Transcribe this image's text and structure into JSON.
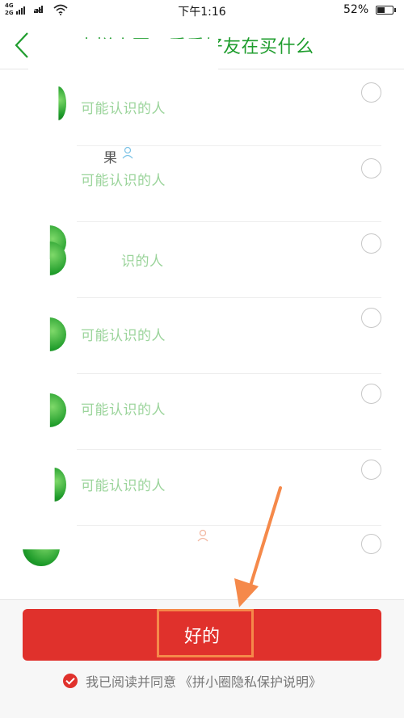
{
  "status_bar": {
    "network_top": "4G",
    "network_bottom": "2G",
    "network2": "2G",
    "time": "下午1:16",
    "battery_percent": "52%",
    "battery_level": 0.52
  },
  "header": {
    "title": "来拼小圈，看看好友在买什么"
  },
  "friends": {
    "subtitle": "可能认识的人",
    "rows": [
      {
        "name": "",
        "subtitle": "可能认识的人"
      },
      {
        "name": "果",
        "subtitle": "可能认识的人"
      },
      {
        "name": "",
        "subtitle": "识的人"
      },
      {
        "name": "",
        "subtitle": "可能认识的人"
      },
      {
        "name": "",
        "subtitle": "可能认识的人"
      },
      {
        "name": "",
        "subtitle": "可能认识的人"
      },
      {
        "name": "",
        "subtitle": ""
      }
    ]
  },
  "bottom": {
    "ok_button": "好的",
    "agree_text": "我已阅读并同意",
    "agree_link": "《拼小圈隐私保护说明》"
  },
  "colors": {
    "accent_green": "#1f9d2e",
    "subtitle_green": "#9bd49b",
    "button_red": "#e0312c",
    "annotation_orange": "#f5894a"
  },
  "icons": [
    "back-arrow-icon",
    "person-icon",
    "radio-circle-icon",
    "checkmark-icon",
    "wifi-icon",
    "battery-icon"
  ]
}
